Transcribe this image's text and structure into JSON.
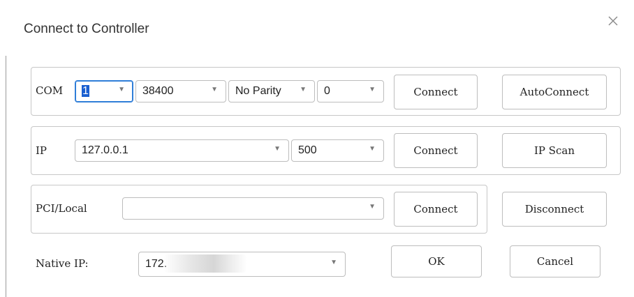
{
  "dialog": {
    "title": "Connect to Controller",
    "close_icon": "close-icon"
  },
  "com_row": {
    "label": "COM",
    "port": "1",
    "baud": "38400",
    "parity": "No Parity",
    "stop": "0",
    "connect": "Connect",
    "auto_connect": "AutoConnect"
  },
  "ip_row": {
    "label": "IP",
    "address": "127.0.0.1",
    "port": "500",
    "connect": "Connect",
    "scan": "IP Scan"
  },
  "pci_row": {
    "label": "PCI/Local",
    "value": "",
    "connect": "Connect",
    "disconnect": "Disconnect"
  },
  "native": {
    "label": "Native IP:",
    "value": "172."
  },
  "footer": {
    "ok": "OK",
    "cancel": "Cancel"
  },
  "colors": {
    "focus_border": "#2f7ed8",
    "selection": "#1a5fd0",
    "group_border": "#c7c7c7"
  }
}
